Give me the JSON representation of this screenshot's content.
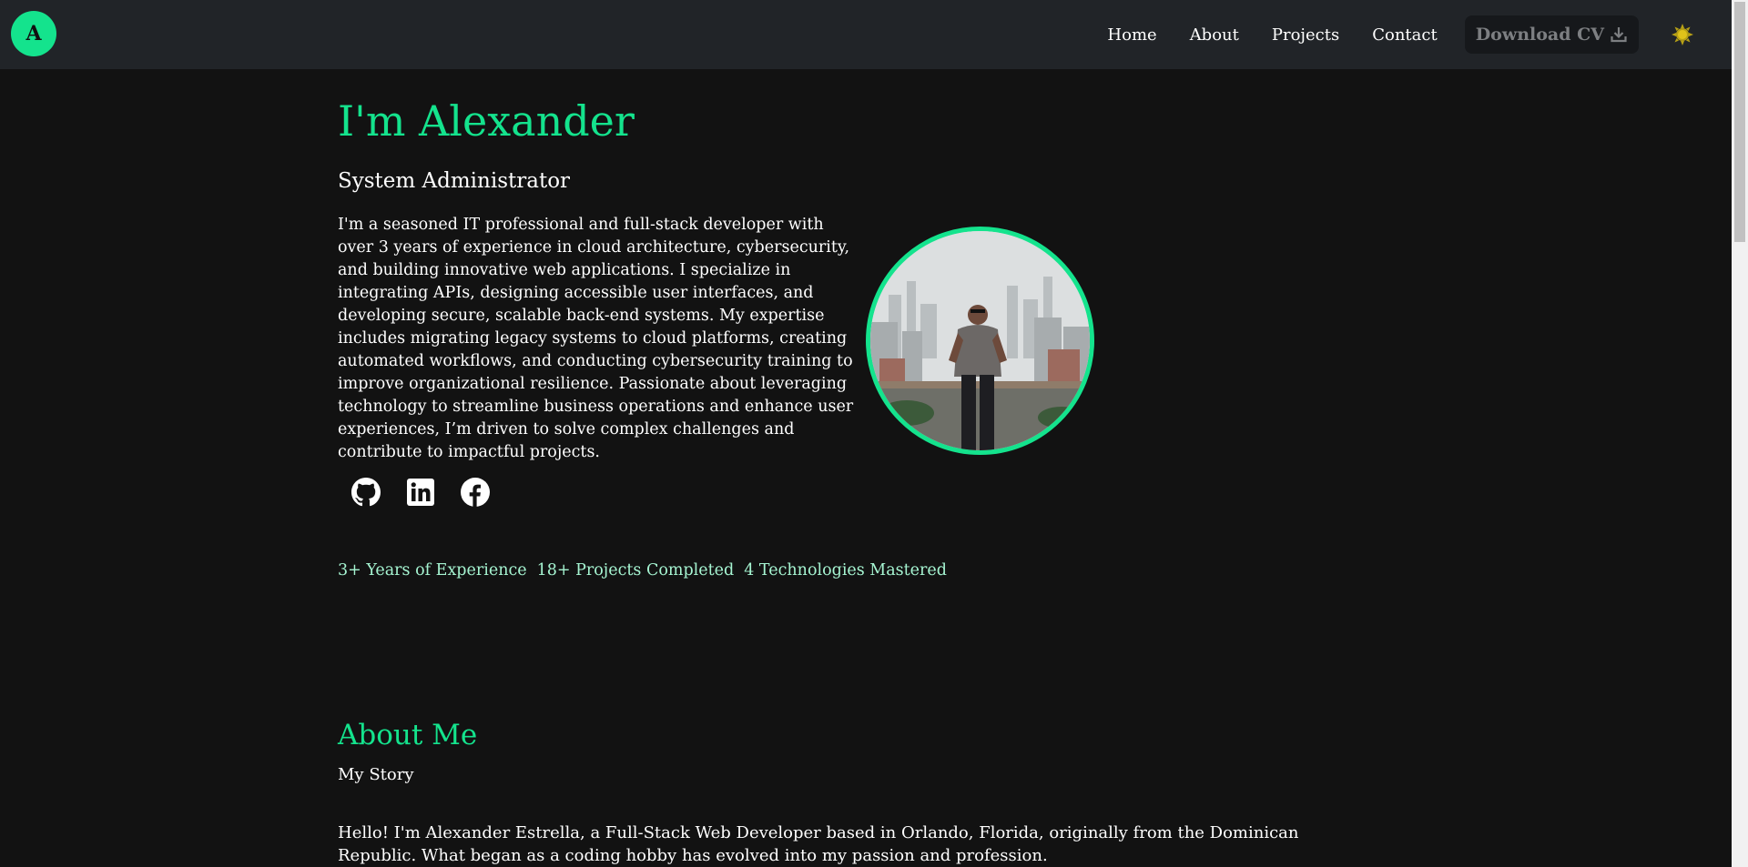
{
  "nav": {
    "logo_letter": "A",
    "links": [
      "Home",
      "About",
      "Projects",
      "Contact"
    ],
    "cv_button_label": "Download CV",
    "theme_toggle_icon": "sun-icon"
  },
  "hero": {
    "title": "I'm Alexander",
    "subtitle": "System Administrator",
    "bio": "I'm a seasoned IT professional and full-stack developer with over 3 years of experience in cloud architecture, cybersecurity, and building innovative web applications. I specialize in integrating APIs, designing accessible user interfaces, and developing secure, scalable back-end systems. My expertise includes migrating legacy systems to cloud platforms, creating automated workflows, and conducting cybersecurity training to improve organizational resilience. Passionate about leveraging technology to streamline business operations and enhance user experiences, I’m driven to solve complex challenges and contribute to impactful projects.",
    "social_icons": [
      "github-icon",
      "linkedin-icon",
      "facebook-icon"
    ],
    "stats": [
      "3+ Years of Experience",
      "18+ Projects Completed",
      "4 Technologies Mastered"
    ]
  },
  "about": {
    "title": "About Me",
    "subtitle": "My Story",
    "body": "Hello! I'm Alexander Estrella, a Full-Stack Web Developer based in Orlando, Florida, originally from the Dominican Republic. What began as a coding hobby has evolved into my passion and profession."
  },
  "colors": {
    "accent": "#14e38d",
    "background": "#121212",
    "navbar": "#212428",
    "stat_text": "#a6f5d2"
  }
}
